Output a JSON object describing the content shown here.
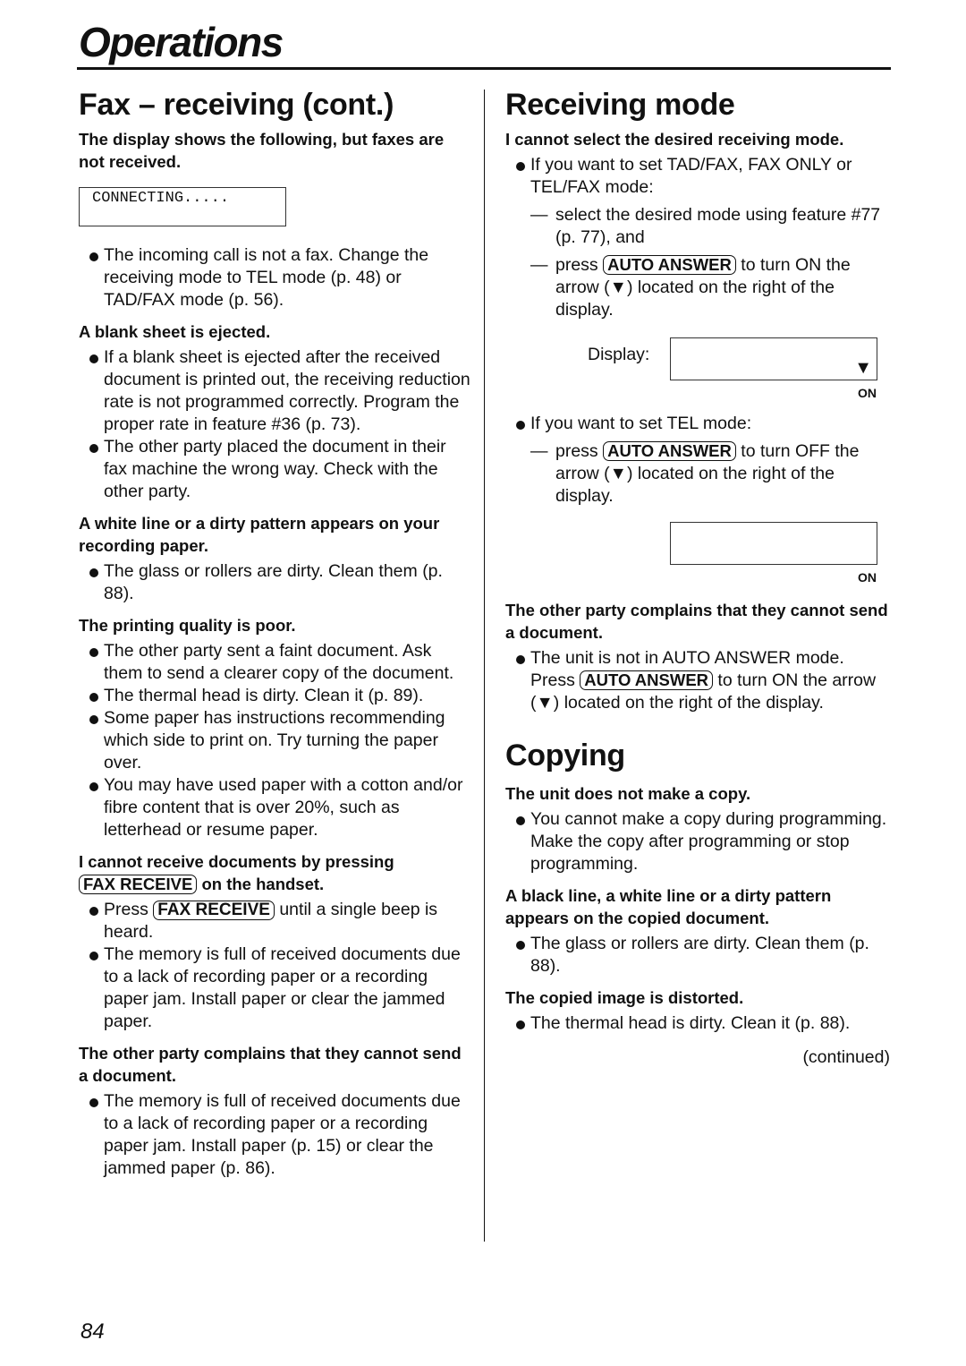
{
  "header": {
    "title": "Operations"
  },
  "left": {
    "heading": "Fax – receiving (cont.)",
    "sections": [
      {
        "title": "The display shows the following, but faxes are not received.",
        "lcd_text": "CONNECTING.....",
        "bullets": [
          "The incoming call is not a fax. Change the receiving mode to TEL mode (p. 48) or TAD/FAX mode (p. 56)."
        ]
      },
      {
        "title": "A blank sheet is ejected.",
        "bullets": [
          "If a blank sheet is ejected after the received document is printed out, the receiving reduction rate is not programmed correctly. Program the proper rate in feature #36 (p. 73).",
          "The other party placed the document in their fax machine the wrong way. Check with the other party."
        ]
      },
      {
        "title": "A white line or a dirty pattern appears on your recording paper.",
        "bullets": [
          "The glass or rollers are dirty. Clean them (p. 88)."
        ]
      },
      {
        "title": "The printing quality is poor.",
        "bullets": [
          "The other party sent a faint document. Ask them to send a clearer copy of the document.",
          "The thermal head is dirty. Clean it (p. 89).",
          "Some paper has instructions recommending which side to print on. Try turning the paper over.",
          "You may have used paper with a cotton and/or fibre content that is over 20%, such as letterhead or resume paper."
        ]
      },
      {
        "title_pre": "I cannot receive documents by pressing ",
        "title_key": "FAX RECEIVE",
        "title_post": " on the handset.",
        "bullet_key_pre": "Press ",
        "bullet_key": "FAX RECEIVE",
        "bullet_key_post": " until a single beep is heard.",
        "bullets": [
          "The memory is full of received documents due to a lack of recording paper or a recording paper jam. Install paper or clear the jammed paper."
        ]
      },
      {
        "title": "The other party complains that they cannot send a document.",
        "bullets": [
          "The memory is full of received documents due to a lack of recording paper or a recording paper jam. Install paper (p. 15) or clear the jammed paper (p. 86)."
        ]
      }
    ]
  },
  "right": {
    "receiving_heading": "Receiving mode",
    "rm_section1": {
      "title": "I cannot select the desired receiving mode.",
      "bullet1": "If you want to set TAD/FAX, FAX ONLY or TEL/FAX mode:",
      "dash1": "select the desired mode using feature #77 (p. 77), and",
      "dash2_pre": "press ",
      "dash2_key": "AUTO ANSWER",
      "dash2_post": " to turn ON the arrow (▼) located on the right of the display.",
      "display_label": "Display:",
      "display_arrow": "▼",
      "on_label": "ON",
      "bullet2": "If you want to set TEL mode:",
      "dash3_pre": "press ",
      "dash3_key": "AUTO ANSWER",
      "dash3_post": " to turn OFF the arrow (▼) located on the right of the display.",
      "on_label2": "ON"
    },
    "rm_section2": {
      "title": "The other party complains that they cannot send a document.",
      "bullet_pre": "The unit is not in AUTO ANSWER mode. Press ",
      "bullet_key": "AUTO ANSWER",
      "bullet_post": " to turn ON the arrow (▼) located on the right of the display."
    },
    "copying_heading": "Copying",
    "copy_sections": [
      {
        "title": "The unit does not make a copy.",
        "bullets": [
          "You cannot make a copy during programming. Make the copy after programming or stop programming."
        ]
      },
      {
        "title": "A black line, a white line or a dirty pattern appears on the copied document.",
        "bullets": [
          "The glass or rollers are dirty. Clean them (p. 88)."
        ]
      },
      {
        "title": "The copied image is distorted.",
        "bullets": [
          "The thermal head is dirty. Clean it (p. 88)."
        ]
      }
    ],
    "continued": "(continued)"
  },
  "footer": {
    "page_number": "84"
  }
}
